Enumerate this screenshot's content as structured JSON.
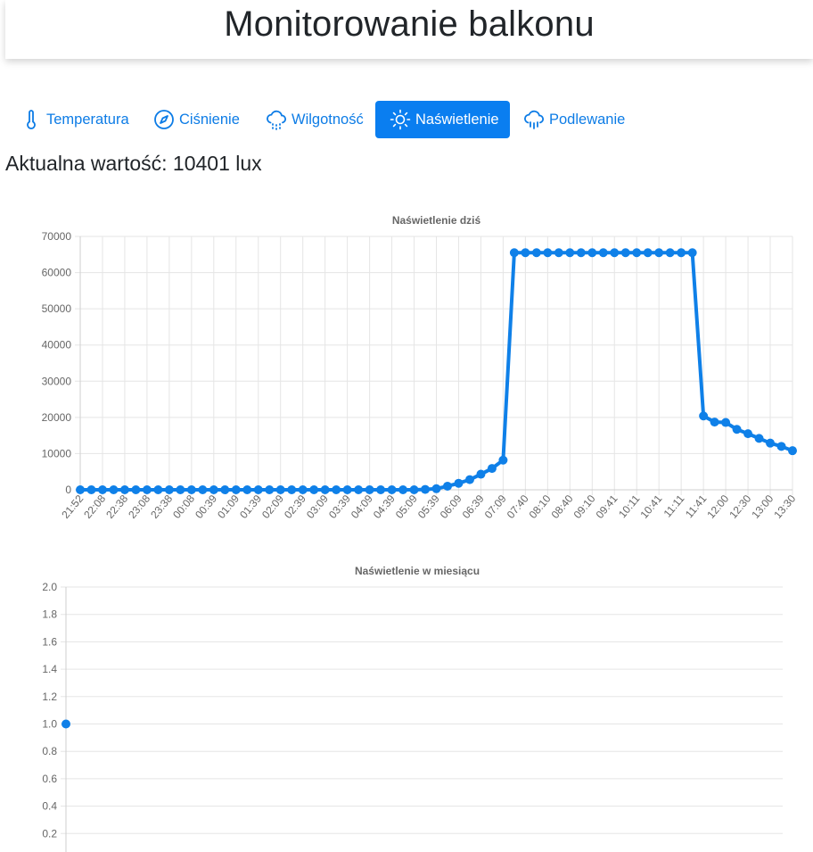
{
  "header": {
    "title": "Monitorowanie balkonu"
  },
  "nav": {
    "items": [
      {
        "label": "Temperatura",
        "icon": "thermometer-icon",
        "active": false
      },
      {
        "label": "Ciśnienie",
        "icon": "compass-icon",
        "active": false
      },
      {
        "label": "Wilgotność",
        "icon": "cloud-drizzle-icon",
        "active": false
      },
      {
        "label": "Naświetlenie",
        "icon": "sun-icon",
        "active": true
      },
      {
        "label": "Podlewanie",
        "icon": "cloud-rain-icon",
        "active": false
      }
    ]
  },
  "current": {
    "text": "Aktualna wartość: 10401 lux"
  },
  "colors": {
    "accent": "#0a7ef0",
    "series": "#0f80e8",
    "grid": "#e5e5e5",
    "text": "#666666"
  },
  "chart_data": [
    {
      "type": "line",
      "title": "Naświetlenie dziś",
      "ylim": [
        0,
        70000
      ],
      "yticks": [
        0,
        10000,
        20000,
        30000,
        40000,
        50000,
        60000,
        70000
      ],
      "grid": true,
      "legend": "none",
      "xtick_labels": [
        "21:52",
        "22:08",
        "22:38",
        "23:08",
        "23:38",
        "00:08",
        "00:39",
        "01:09",
        "01:39",
        "02:09",
        "02:39",
        "03:09",
        "03:39",
        "04:09",
        "04:39",
        "05:09",
        "05:39",
        "06:09",
        "06:39",
        "07:09",
        "07:40",
        "08:10",
        "08:40",
        "09:10",
        "09:41",
        "10:11",
        "10:41",
        "11:11",
        "11:41",
        "12:00",
        "12:30",
        "13:00",
        "13:30"
      ],
      "series": [
        {
          "values": [
            0,
            0,
            0,
            0,
            0,
            0,
            0,
            0,
            0,
            0,
            0,
            0,
            0,
            0,
            0,
            0,
            0,
            0,
            0,
            0,
            0,
            0,
            0,
            0,
            0,
            0,
            0,
            0,
            0,
            0,
            0,
            100,
            300,
            1000,
            1800,
            2800,
            4300,
            5900,
            8200,
            65500,
            65500,
            65500,
            65500,
            65500,
            65500,
            65500,
            65500,
            65500,
            65500,
            65500,
            65500,
            65500,
            65500,
            65500,
            65500,
            65500,
            20400,
            18700,
            18600,
            16700,
            15500,
            14200,
            12900,
            12000,
            10800
          ]
        }
      ]
    },
    {
      "type": "line",
      "title": "Naświetlenie w miesiącu",
      "ylim": [
        0,
        2.0
      ],
      "yticks": [
        "0.2",
        "0.4",
        "0.6",
        "0.8",
        "1.0",
        "1.2",
        "1.4",
        "1.6",
        "1.8",
        "2.0"
      ],
      "grid": true,
      "legend": "none",
      "series": [
        {
          "values": [
            1.0
          ]
        }
      ]
    }
  ]
}
